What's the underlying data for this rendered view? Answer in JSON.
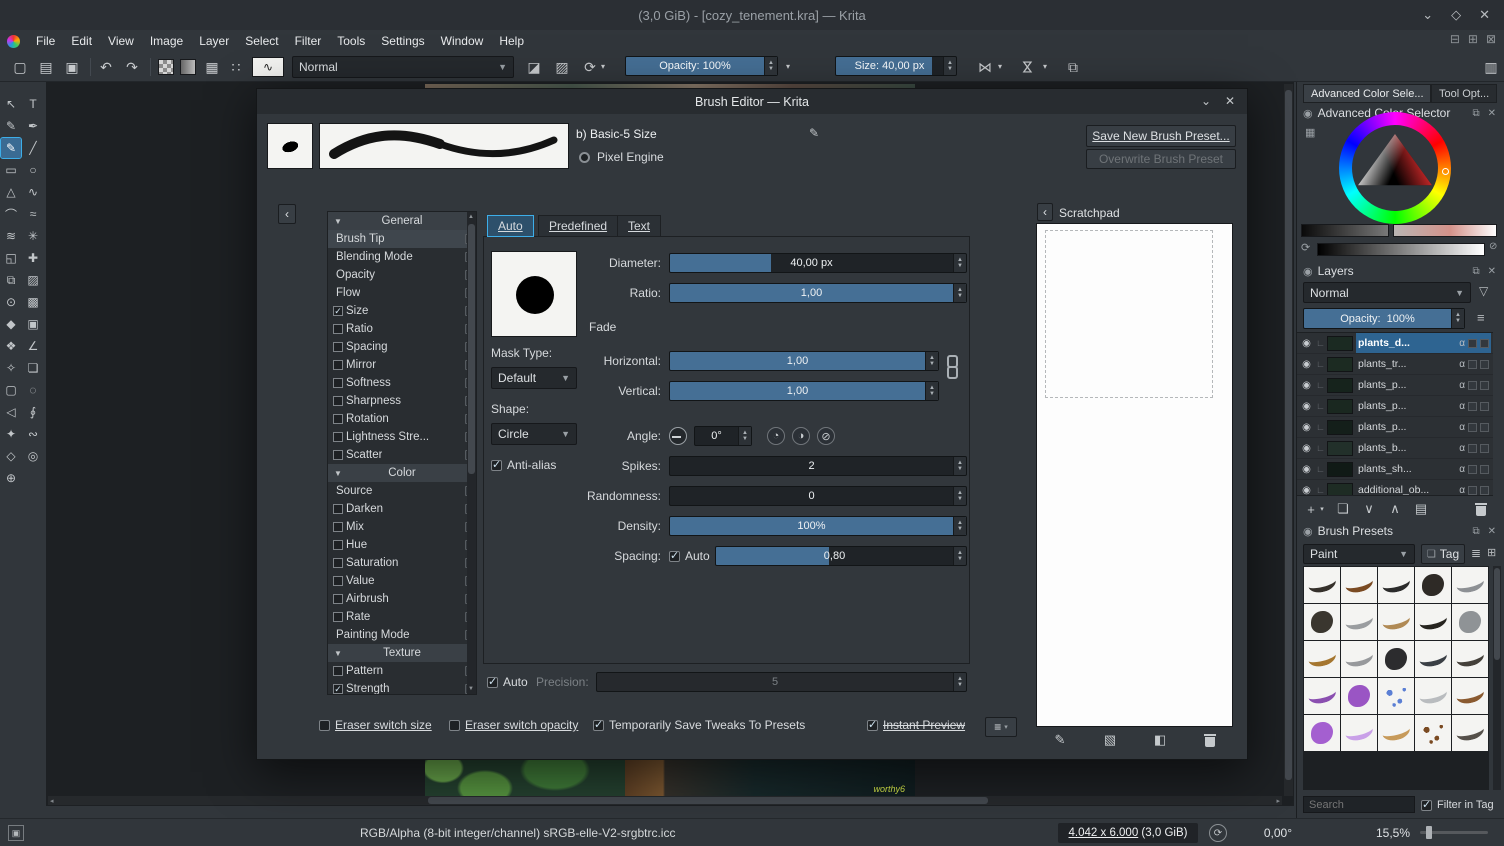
{
  "titlebar": {
    "title": "(3,0 GiB) - [cozy_tenement.kra] — Krita"
  },
  "menubar": {
    "items": [
      "File",
      "Edit",
      "View",
      "Image",
      "Layer",
      "Select",
      "Filter",
      "Tools",
      "Settings",
      "Window",
      "Help"
    ]
  },
  "toolbar": {
    "blend_mode": "Normal",
    "opacity": "Opacity: 100%",
    "size": "Size: 40,00 px"
  },
  "toolbox": {
    "tools": [
      {
        "name": "select-shapes",
        "glyph": "↖"
      },
      {
        "name": "text",
        "glyph": "T"
      },
      {
        "name": "edit-shapes",
        "glyph": "✎"
      },
      {
        "name": "calligraphy",
        "glyph": "✒"
      },
      {
        "name": "freehand-brush",
        "glyph": "✎",
        "active": true
      },
      {
        "name": "line",
        "glyph": "╱"
      },
      {
        "name": "rectangle",
        "glyph": "▭"
      },
      {
        "name": "ellipse",
        "glyph": "○"
      },
      {
        "name": "polygon",
        "glyph": "△"
      },
      {
        "name": "polyline",
        "glyph": "∿"
      },
      {
        "name": "bezier-curve",
        "glyph": "⌒"
      },
      {
        "name": "freehand-path",
        "glyph": "≈"
      },
      {
        "name": "dynamic-brush",
        "glyph": "≋"
      },
      {
        "name": "multibrush",
        "glyph": "✳"
      },
      {
        "name": "transform",
        "glyph": "◱"
      },
      {
        "name": "move",
        "glyph": "✚"
      },
      {
        "name": "crop",
        "glyph": "⧉"
      },
      {
        "name": "gradient",
        "glyph": "▨"
      },
      {
        "name": "color-sampler",
        "glyph": "⊙"
      },
      {
        "name": "pattern-edit",
        "glyph": "▩"
      },
      {
        "name": "fill",
        "glyph": "◆"
      },
      {
        "name": "enclose-fill",
        "glyph": "▣"
      },
      {
        "name": "smart-patch",
        "glyph": "❖"
      },
      {
        "name": "measure",
        "glyph": "∠"
      },
      {
        "name": "assistants",
        "glyph": "✧"
      },
      {
        "name": "reference-images",
        "glyph": "❏"
      },
      {
        "name": "rect-select",
        "glyph": "▢"
      },
      {
        "name": "ellipse-select",
        "glyph": "◌"
      },
      {
        "name": "polygon-select",
        "glyph": "◁"
      },
      {
        "name": "freehand-select",
        "glyph": "∮"
      },
      {
        "name": "similar-select",
        "glyph": "✦"
      },
      {
        "name": "magnetic-select",
        "glyph": "∾"
      },
      {
        "name": "bezier-select",
        "glyph": "◇"
      },
      {
        "name": "zoom",
        "glyph": "◎"
      },
      {
        "name": "pan",
        "glyph": "⊕"
      }
    ]
  },
  "dialog": {
    "title": "Brush Editor — Krita",
    "preset_name": "b) Basic-5 Size",
    "engine_label": "Pixel Engine",
    "save_button": "Save New Brush Preset...",
    "overwrite_button": "Overwrite Brush Preset",
    "tabs": {
      "auto": "Auto",
      "predefined": "Predefined",
      "text": "Text"
    },
    "options": {
      "rows": [
        {
          "t": "header",
          "label": "General"
        },
        {
          "t": "item",
          "label": "Brush Tip",
          "active": true
        },
        {
          "t": "item",
          "label": "Blending Mode"
        },
        {
          "t": "item",
          "label": "Opacity"
        },
        {
          "t": "item",
          "label": "Flow"
        },
        {
          "t": "check",
          "label": "Size",
          "checked": true
        },
        {
          "t": "check",
          "label": "Ratio"
        },
        {
          "t": "check",
          "label": "Spacing"
        },
        {
          "t": "check",
          "label": "Mirror"
        },
        {
          "t": "check",
          "label": "Softness"
        },
        {
          "t": "check",
          "label": "Sharpness"
        },
        {
          "t": "check",
          "label": "Rotation"
        },
        {
          "t": "check",
          "label": "Lightness Stre..."
        },
        {
          "t": "check",
          "label": "Scatter"
        },
        {
          "t": "header",
          "label": "Color"
        },
        {
          "t": "item",
          "label": "Source"
        },
        {
          "t": "check",
          "label": "Darken"
        },
        {
          "t": "check",
          "label": "Mix"
        },
        {
          "t": "check",
          "label": "Hue"
        },
        {
          "t": "check",
          "label": "Saturation"
        },
        {
          "t": "check",
          "label": "Value"
        },
        {
          "t": "check",
          "label": "Airbrush"
        },
        {
          "t": "check",
          "label": "Rate"
        },
        {
          "t": "item",
          "label": "Painting Mode"
        },
        {
          "t": "header",
          "label": "Texture"
        },
        {
          "t": "check",
          "label": "Pattern"
        },
        {
          "t": "check",
          "label": "Strength",
          "checked": true
        }
      ]
    },
    "auto": {
      "diameter_label": "Diameter:",
      "diameter": "40,00 px",
      "ratio_label": "Ratio:",
      "ratio": "1,00",
      "fade_label": "Fade",
      "mask_type_label": "Mask Type:",
      "mask_type": "Default",
      "horizontal_label": "Horizontal:",
      "horizontal": "1,00",
      "vertical_label": "Vertical:",
      "vertical": "1,00",
      "shape_label": "Shape:",
      "shape": "Circle",
      "angle_label": "Angle:",
      "angle": "0°",
      "antialias_label": "Anti-alias",
      "spikes_label": "Spikes:",
      "spikes": "2",
      "randomness_label": "Randomness:",
      "randomness": "0",
      "density_label": "Density:",
      "density": "100%",
      "spacing_label": "Spacing:",
      "spacing_auto_label": "Auto",
      "spacing": "0,80",
      "auto_label": "Auto",
      "precision_label": "Precision:",
      "precision": "5"
    },
    "footer": {
      "eraser_size": "Eraser switch size",
      "eraser_opacity": "Eraser switch opacity",
      "tweaks": "Temporarily Save Tweaks To Presets",
      "instant": "Instant Preview"
    },
    "scratchpad": {
      "title": "Scratchpad"
    }
  },
  "rightdock": {
    "tabs": [
      "Advanced Color Sele...",
      "Tool Opt..."
    ],
    "color_selector_title": "Advanced Color Selector",
    "layers": {
      "title": "Layers",
      "blend": "Normal",
      "opacity": "Opacity:  100%",
      "rows": [
        {
          "name": "plants_d...",
          "sel": true,
          "thumb": "checker"
        },
        {
          "name": "plants_tr...",
          "thumb": "#1c2b22"
        },
        {
          "name": "plants_p...",
          "thumb": "#16231c"
        },
        {
          "name": "plants_p...",
          "thumb": "#1a2820"
        },
        {
          "name": "plants_p...",
          "thumb": "#141f1a"
        },
        {
          "name": "plants_b...",
          "thumb": "#22302a"
        },
        {
          "name": "plants_sh...",
          "thumb": "#101a16"
        },
        {
          "name": "additional_ob...",
          "thumb": "#1e2c24"
        }
      ]
    },
    "presets": {
      "title": "Brush Presets",
      "tag_filter": "Paint",
      "tag_button": "Tag",
      "search_placeholder": "Search",
      "filter_in_tag": "Filter in Tag",
      "cells": [
        {
          "s": "arc",
          "c": "#35302b"
        },
        {
          "s": "arc",
          "c": "#7a4a22"
        },
        {
          "s": "arc",
          "c": "#2b2b2b"
        },
        {
          "s": "blob",
          "c": "#2e2a26"
        },
        {
          "s": "arc",
          "c": "#8d9094"
        },
        {
          "s": "blob",
          "c": "#3a362f"
        },
        {
          "s": "arc",
          "c": "#9a9da0"
        },
        {
          "s": "arc",
          "c": "#b08a55"
        },
        {
          "s": "arc",
          "c": "#26241f"
        },
        {
          "s": "blob",
          "c": "#8f9396"
        },
        {
          "s": "arc",
          "c": "#a5762f"
        },
        {
          "s": "arc",
          "c": "#97999c"
        },
        {
          "s": "blob",
          "c": "#2c2c2e"
        },
        {
          "s": "arc",
          "c": "#3a3f45"
        },
        {
          "s": "arc",
          "c": "#44403a"
        },
        {
          "s": "arc",
          "c": "#8a4fb0"
        },
        {
          "s": "blob",
          "c": "#9a55c4"
        },
        {
          "s": "splat",
          "c": "#5b7fd4"
        },
        {
          "s": "arc",
          "c": "#b9bcbf"
        },
        {
          "s": "arc",
          "c": "#8a5a30"
        },
        {
          "s": "blob",
          "c": "#a45fd0"
        },
        {
          "s": "arc",
          "c": "#c9a0e8"
        },
        {
          "s": "arc",
          "c": "#c79a5a"
        },
        {
          "s": "splat",
          "c": "#7a4a22"
        },
        {
          "s": "arc",
          "c": "#55504a"
        }
      ]
    }
  },
  "statusbar": {
    "color_profile": "RGB/Alpha (8-bit integer/channel)  sRGB-elle-V2-srgbtrc.icc",
    "dims": "4.042 x 6.000",
    "mem": " (3,0 GiB)",
    "angle": "0,00°",
    "zoom": "15,5%"
  },
  "art": {
    "signature": "worthy6"
  },
  "colors": {
    "accent": "#3daee9",
    "slider_fill": "#456f95"
  }
}
